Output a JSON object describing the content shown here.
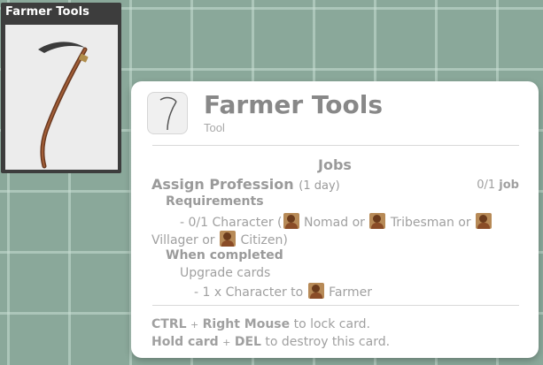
{
  "card": {
    "title": "Farmer Tools",
    "icon": "scythe-icon"
  },
  "tooltip": {
    "title": "Farmer Tools",
    "subtitle": "Tool",
    "icon": "scythe-icon",
    "section_title": "Jobs",
    "job": {
      "name": "Assign Profession",
      "duration": "(1 day)",
      "count": "0/1",
      "count_unit": "job"
    },
    "requirements": {
      "label": "Requirements",
      "prefix": "- 0/1 Character (",
      "options": [
        "Nomad",
        "Tribesman",
        "Villager",
        "Citizen"
      ],
      "joiner": "or",
      "suffix": ")"
    },
    "completion": {
      "label": "When completed",
      "action": "Upgrade cards",
      "detail_prefix": "- 1 x Character to",
      "detail_target": "Farmer"
    },
    "hints": {
      "line1_key1": "CTRL",
      "line1_plus": "+",
      "line1_key2": "Right Mouse",
      "line1_text": "to lock card.",
      "line2_key1": "Hold card",
      "line2_plus": "+",
      "line2_key2": "DEL",
      "line2_text": "to destroy this card."
    }
  }
}
